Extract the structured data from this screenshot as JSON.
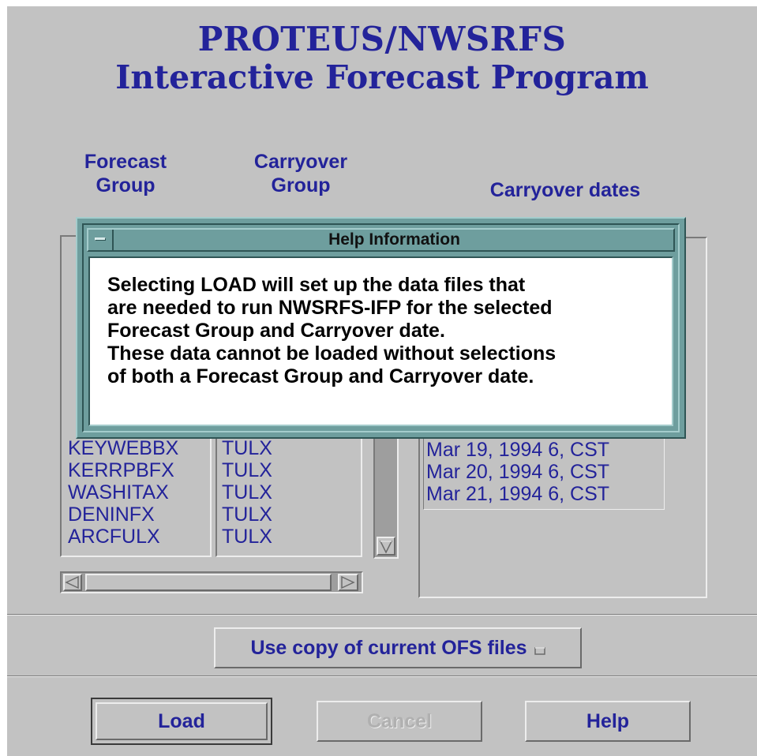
{
  "header": {
    "title_line1": "PROTEUS/NWSRFS",
    "title_line2": "Interactive Forecast Program"
  },
  "columns": {
    "forecast_group": "Forecast\nGroup",
    "carryover_group": "Carryover\nGroup",
    "carryover_dates": "Carryover dates"
  },
  "forecast_groups": [
    "KEYWEBBX",
    "KERRPBFX",
    "WASHITAX",
    "DENINFX",
    "ARCFULX"
  ],
  "carryover_groups": [
    "TULX",
    "TULX",
    "TULX",
    "TULX",
    "TULX"
  ],
  "carryover_dates": [
    "Mar 19, 1994  6, CST",
    "Mar 20, 1994  6, CST",
    "Mar 21, 1994  6, CST"
  ],
  "option_button": {
    "label": "Use copy of current OFS files"
  },
  "buttons": {
    "load": "Load",
    "cancel": "Cancel",
    "help": "Help"
  },
  "help_dialog": {
    "title": "Help Information",
    "lines": [
      "Selecting LOAD will set up the data files that",
      "are needed to run NWSRFS-IFP for the selected",
      "Forecast Group and Carryover date.",
      "These data cannot be loaded without selections",
      "of both a Forecast Group and Carryover date."
    ]
  },
  "colors": {
    "background": "#c2c2c2",
    "accent_text": "#23239a",
    "dialog_frame": "#6e9e9e"
  },
  "icons": {
    "scroll_up": "triangle-up-icon",
    "scroll_down": "triangle-down-icon",
    "scroll_left": "triangle-left-icon",
    "scroll_right": "triangle-right-icon",
    "option_indicator": "option-menu-icon",
    "window_menu": "window-menu-icon"
  }
}
